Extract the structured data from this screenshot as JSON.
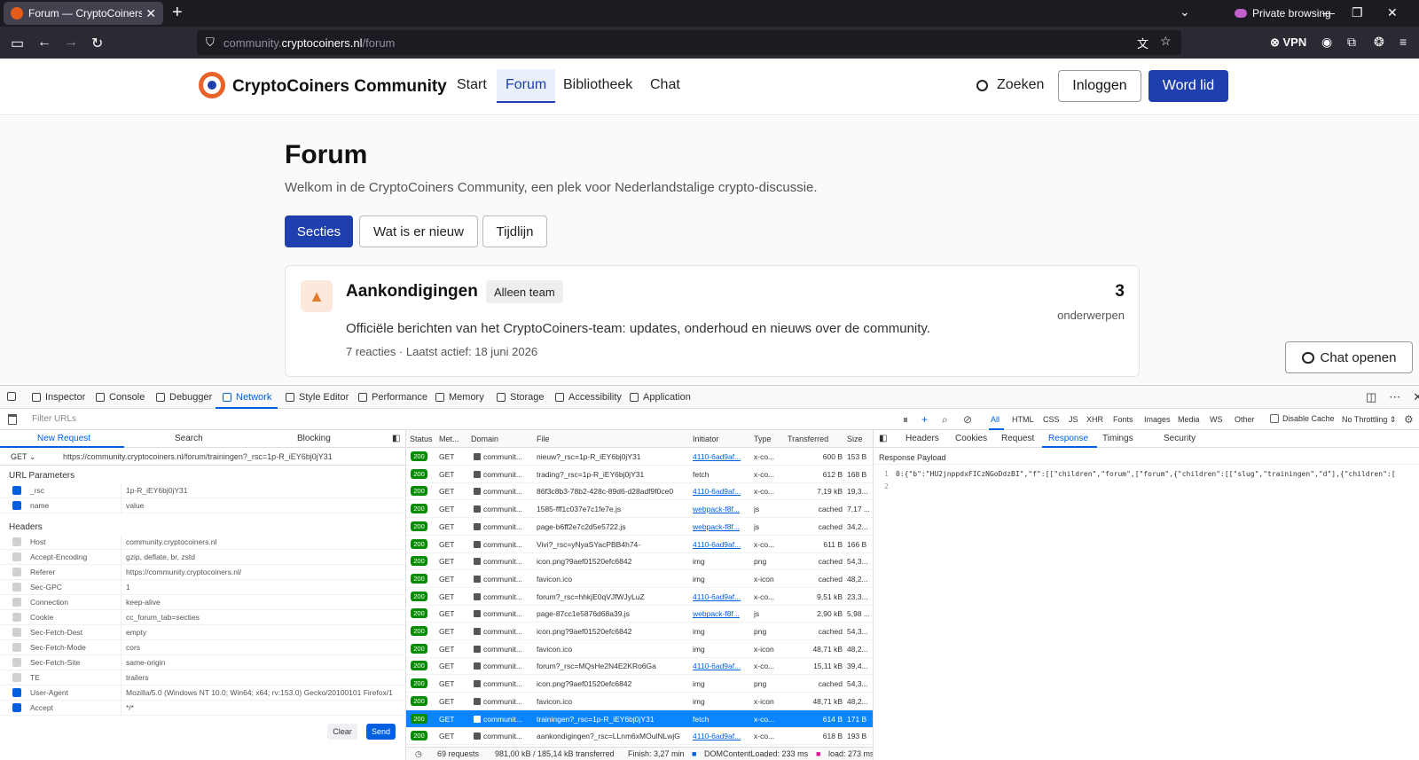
{
  "browser": {
    "tab_title": "Forum — CryptoCoiners Comm",
    "private_label": "Private browsing",
    "url_prefix": "community.",
    "url_domain": "cryptocoiners.nl",
    "url_path": "/forum",
    "vpn_label": "VPN"
  },
  "site": {
    "brand": "CryptoCoiners Community",
    "nav": [
      "Start",
      "Forum",
      "Bibliotheek",
      "Chat"
    ],
    "search_label": "Zoeken",
    "login_label": "Inloggen",
    "join_label": "Word lid"
  },
  "page": {
    "title": "Forum",
    "subtitle": "Welkom in de CryptoCoiners Community, een plek voor Nederlandstalige crypto-discussie.",
    "pills": [
      "Secties",
      "Wat is er nieuw",
      "Tijdlijn"
    ],
    "card": {
      "title": "Aankondigingen",
      "badge": "Alleen team",
      "description": "Officiële berichten van het CryptoCoiners-team: updates, onderhoud en nieuws over de community.",
      "meta": "7 reacties · Laatst actief: 18 juni 2026",
      "count": "3",
      "count_label": "onderwerpen"
    },
    "chat_button": "Chat openen"
  },
  "devtools": {
    "tabs": [
      "Inspector",
      "Console",
      "Debugger",
      "Network",
      "Style Editor",
      "Performance",
      "Memory",
      "Storage",
      "Accessibility",
      "Application"
    ],
    "filter_placeholder": "Filter URLs",
    "type_filters": [
      "All",
      "HTML",
      "CSS",
      "JS",
      "XHR",
      "Fonts",
      "Images",
      "Media",
      "WS",
      "Other"
    ],
    "disable_cache": "Disable Cache",
    "throttling": "No Throttling ⇕",
    "left_tabs": [
      "New Request",
      "Search",
      "Blocking"
    ],
    "method": "GET",
    "request_url": "https://community.cryptocoiners.nl/forum/trainingen?_rsc=1p-R_iEY6bj0jY31",
    "url_params_title": "URL Parameters",
    "url_params": [
      {
        "k": "_rsc",
        "v": "1p-R_iEY6bj0jY31",
        "on": true
      },
      {
        "k": "name",
        "v": "value",
        "on": true
      }
    ],
    "headers_title": "Headers",
    "headers": [
      {
        "k": "Host",
        "v": "community.cryptocoiners.nl",
        "on": false
      },
      {
        "k": "Accept-Encoding",
        "v": "gzip, deflate, br, zstd",
        "on": false
      },
      {
        "k": "Referer",
        "v": "https://community.cryptocoiners.nl/",
        "on": false
      },
      {
        "k": "Sec-GPC",
        "v": "1",
        "on": false
      },
      {
        "k": "Connection",
        "v": "keep-alive",
        "on": false
      },
      {
        "k": "Cookie",
        "v": "cc_forum_tab=secties",
        "on": false
      },
      {
        "k": "Sec-Fetch-Dest",
        "v": "empty",
        "on": false
      },
      {
        "k": "Sec-Fetch-Mode",
        "v": "cors",
        "on": false
      },
      {
        "k": "Sec-Fetch-Site",
        "v": "same-origin",
        "on": false
      },
      {
        "k": "TE",
        "v": "trailers",
        "on": false
      },
      {
        "k": "User-Agent",
        "v": "Mozilla/5.0 (Windows NT 10.0; Win64; x64; rv:153.0) Gecko/20100101 Firefox/1",
        "on": true
      },
      {
        "k": "Accept",
        "v": "*/*",
        "on": true
      }
    ],
    "clear_label": "Clear",
    "send_label": "Send",
    "columns": [
      "Status",
      "Met...",
      "Domain",
      "File",
      "Initiator",
      "Type",
      "Transferred",
      "Size"
    ],
    "rows": [
      {
        "status": "200",
        "method": "GET",
        "domain": "communit...",
        "file": "nieuw?_rsc=1p-R_iEY6bj0jY31",
        "initiator": "4110-6ad9af...",
        "init_link": true,
        "type": "x-co...",
        "transferred": "600 B",
        "size": "153 B"
      },
      {
        "status": "200",
        "method": "GET",
        "domain": "communit...",
        "file": "trading?_rsc=1p-R_iEY6bj0jY31",
        "initiator": "fetch",
        "init_link": false,
        "type": "x-co...",
        "transferred": "612 B",
        "size": "168 B"
      },
      {
        "status": "200",
        "method": "GET",
        "domain": "communit...",
        "file": "86f3c8b3-78b2-428c-89d6-d28adf9f0ce0",
        "initiator": "4110-6ad9af...",
        "init_link": true,
        "type": "x-co...",
        "transferred": "7,19 kB",
        "size": "19,3..."
      },
      {
        "status": "200",
        "method": "GET",
        "domain": "communit...",
        "file": "1585-fff1c037e7c1fe7e.js",
        "initiator": "webpack-f8f...",
        "init_link": true,
        "type": "js",
        "transferred": "cached",
        "size": "7,17 ..."
      },
      {
        "status": "200",
        "method": "GET",
        "domain": "communit...",
        "file": "page-b6ff2e7c2d5e5722.js",
        "initiator": "webpack-f8f...",
        "init_link": true,
        "type": "js",
        "transferred": "cached",
        "size": "34,2..."
      },
      {
        "status": "200",
        "method": "GET",
        "domain": "communit...",
        "file": "Vivi?_rsc=yNyaSYacPBB4h74-",
        "initiator": "4110-6ad9af...",
        "init_link": true,
        "type": "x-co...",
        "transferred": "611 B",
        "size": "166 B"
      },
      {
        "status": "200",
        "method": "GET",
        "domain": "communit...",
        "file": "icon.png?9aef01520efc6842",
        "initiator": "img",
        "init_link": false,
        "type": "png",
        "transferred": "cached",
        "size": "54,3..."
      },
      {
        "status": "200",
        "method": "GET",
        "domain": "communit...",
        "file": "favicon.ico",
        "initiator": "img",
        "init_link": false,
        "type": "x-icon",
        "transferred": "cached",
        "size": "48,2..."
      },
      {
        "status": "200",
        "method": "GET",
        "domain": "communit...",
        "file": "forum?_rsc=hhkjE0qVJfWJyLuZ",
        "initiator": "4110-6ad9af...",
        "init_link": true,
        "type": "x-co...",
        "transferred": "9,51 kB",
        "size": "23,3..."
      },
      {
        "status": "200",
        "method": "GET",
        "domain": "communit...",
        "file": "page-87cc1e5876d68a39.js",
        "initiator": "webpack-f8f...",
        "init_link": true,
        "type": "js",
        "transferred": "2,90 kB",
        "size": "5,98 ..."
      },
      {
        "status": "200",
        "method": "GET",
        "domain": "communit...",
        "file": "icon.png?9aef01520efc6842",
        "initiator": "img",
        "init_link": false,
        "type": "png",
        "transferred": "cached",
        "size": "54,3..."
      },
      {
        "status": "200",
        "method": "GET",
        "domain": "communit...",
        "file": "favicon.ico",
        "initiator": "img",
        "init_link": false,
        "type": "x-icon",
        "transferred": "48,71 kB",
        "size": "48,2..."
      },
      {
        "status": "200",
        "method": "GET",
        "domain": "communit...",
        "file": "forum?_rsc=MQsHe2N4E2KRo6Ga",
        "initiator": "4110-6ad9af...",
        "init_link": true,
        "type": "x-co...",
        "transferred": "15,11 kB",
        "size": "39,4..."
      },
      {
        "status": "200",
        "method": "GET",
        "domain": "communit...",
        "file": "icon.png?9aef01520efc6842",
        "initiator": "img",
        "init_link": false,
        "type": "png",
        "transferred": "cached",
        "size": "54,3..."
      },
      {
        "status": "200",
        "method": "GET",
        "domain": "communit...",
        "file": "favicon.ico",
        "initiator": "img",
        "init_link": false,
        "type": "x-icon",
        "transferred": "48,71 kB",
        "size": "48,2..."
      },
      {
        "status": "200",
        "method": "GET",
        "domain": "communit...",
        "file": "trainingen?_rsc=1p-R_iEY6bj0jY31",
        "initiator": "fetch",
        "init_link": false,
        "type": "x-co...",
        "transferred": "614 B",
        "size": "171 B",
        "selected": true
      },
      {
        "status": "200",
        "method": "GET",
        "domain": "communit...",
        "file": "aankondigingen?_rsc=LLnm6xMOulNLwjG",
        "initiator": "4110-6ad9af...",
        "init_link": true,
        "type": "x-co...",
        "transferred": "618 B",
        "size": "193 B"
      }
    ],
    "status_bar": {
      "requests": "69 requests",
      "transferred": "981,00 kB / 185,14 kB transferred",
      "finish": "Finish: 3,27 min",
      "domcontent": "DOMContentLoaded: 233 ms",
      "load": "load: 273 ms"
    },
    "right_tabs": [
      "Headers",
      "Cookies",
      "Request",
      "Response",
      "Timings",
      "Security"
    ],
    "payload_label": "Response Payload",
    "payload_line1": "0:{\"b\":\"HU2jnppdxFICzNGoDdzBI\",\"f\":[[\"children\",\"forum\",[\"forum\",{\"children\":[[\"slug\",\"trainingen\",\"d\"],{\"children\":[",
    "line_numbers": [
      "1",
      "2"
    ]
  }
}
